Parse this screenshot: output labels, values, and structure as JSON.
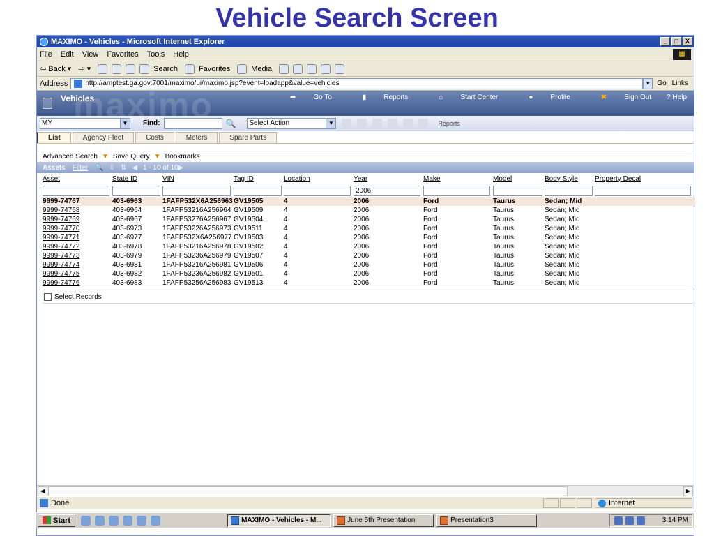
{
  "slide": {
    "title": "Vehicle Search Screen"
  },
  "window": {
    "title": "MAXIMO - Vehicles - Microsoft Internet Explorer",
    "min": "_",
    "max": "□",
    "close": "X"
  },
  "menubar": [
    "File",
    "Edit",
    "View",
    "Favorites",
    "Tools",
    "Help"
  ],
  "toolbar": {
    "back": "⇦ Back ▾",
    "forward": "⇨ ▾",
    "search": "Search",
    "favorites": "Favorites",
    "media": "Media"
  },
  "address": {
    "label": "Address",
    "url": "http://amptest.ga.gov:7001/maximo/ui/maximo.jsp?event=loadapp&value=vehicles",
    "go": "Go",
    "links": "Links"
  },
  "maximo": {
    "app_title": "Vehicles",
    "watermark": "maximo",
    "nav": {
      "goto": "Go To",
      "reports": "Reports",
      "start_center": "Start Center",
      "profile": "Profile",
      "signout": "Sign Out",
      "help": "? Help"
    }
  },
  "actionbar": {
    "query_select": "MY",
    "find_label": "Find:",
    "find_value": "",
    "select_action": "Select Action",
    "reports": "Reports"
  },
  "tabs": [
    "List",
    "Agency Fleet",
    "Costs",
    "Meters",
    "Spare Parts"
  ],
  "subnav": {
    "advanced_search": "Advanced Search",
    "save_query": "Save Query",
    "bookmarks": "Bookmarks"
  },
  "results": {
    "title": "Assets",
    "filter": "Filter",
    "paging": "1 - 10 of 10",
    "columns": [
      "Asset",
      "State ID",
      "VIN",
      "Tag ID",
      "Location",
      "Year",
      "Make",
      "Model",
      "Body Style",
      "Property Decal"
    ],
    "filters": [
      "",
      "",
      "",
      "",
      "",
      "2006",
      "",
      "",
      "",
      ""
    ],
    "rows": [
      [
        "9999-74767",
        "403-6963",
        "1FAFP532X6A256963",
        "GV19505",
        "4",
        "2006",
        "Ford",
        "Taurus",
        "Sedan; Mid",
        ""
      ],
      [
        "9999-74768",
        "403-6964",
        "1FAFP53216A256964",
        "GV19509",
        "4",
        "2006",
        "Ford",
        "Taurus",
        "Sedan; Mid",
        ""
      ],
      [
        "9999-74769",
        "403-6967",
        "1FAFP53276A256967",
        "GV19504",
        "4",
        "2006",
        "Ford",
        "Taurus",
        "Sedan; Mid",
        ""
      ],
      [
        "9999-74770",
        "403-6973",
        "1FAFP53226A256973",
        "GV19511",
        "4",
        "2006",
        "Ford",
        "Taurus",
        "Sedan; Mid",
        ""
      ],
      [
        "9999-74771",
        "403-6977",
        "1FAFP532X6A256977",
        "GV19503",
        "4",
        "2006",
        "Ford",
        "Taurus",
        "Sedan; Mid",
        ""
      ],
      [
        "9999-74772",
        "403-6978",
        "1FAFP53216A256978",
        "GV19502",
        "4",
        "2006",
        "Ford",
        "Taurus",
        "Sedan; Mid",
        ""
      ],
      [
        "9999-74773",
        "403-6979",
        "1FAFP53236A256979",
        "GV19507",
        "4",
        "2006",
        "Ford",
        "Taurus",
        "Sedan; Mid",
        ""
      ],
      [
        "9999-74774",
        "403-6981",
        "1FAFP53216A256981",
        "GV19506",
        "4",
        "2006",
        "Ford",
        "Taurus",
        "Sedan; Mid",
        ""
      ],
      [
        "9999-74775",
        "403-6982",
        "1FAFP53236A256982",
        "GV19501",
        "4",
        "2006",
        "Ford",
        "Taurus",
        "Sedan; Mid",
        ""
      ],
      [
        "9999-74776",
        "403-6983",
        "1FAFP53256A256983",
        "GV19513",
        "4",
        "2006",
        "Ford",
        "Taurus",
        "Sedan; Mid",
        ""
      ]
    ],
    "select_records": "Select Records"
  },
  "status": {
    "text": "Done",
    "zone": "Internet"
  },
  "taskbar": {
    "start": "Start",
    "tasks": [
      "MAXIMO - Vehicles - M...",
      "June 5th Presentation",
      "Presentation3"
    ],
    "clock": "3:14 PM"
  }
}
